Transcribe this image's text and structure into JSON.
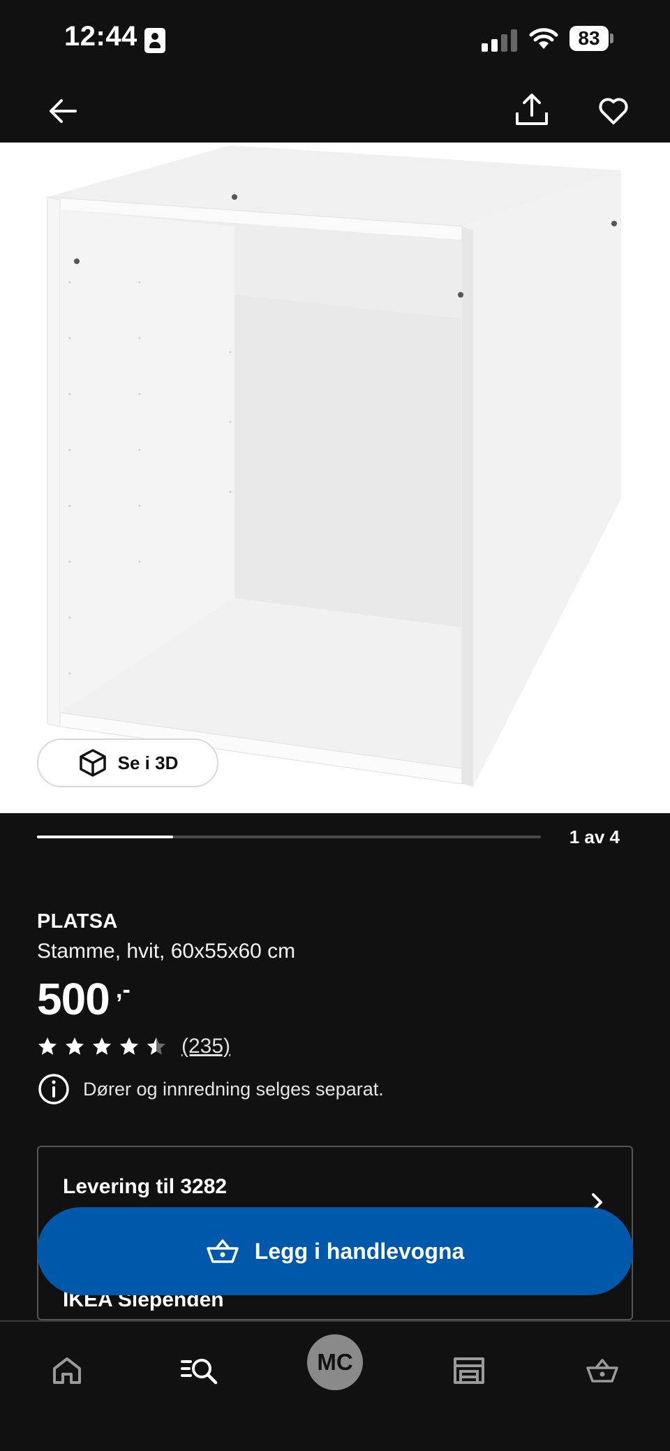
{
  "status_bar": {
    "time": "12:44",
    "battery": "83"
  },
  "product": {
    "image_counter": "1 av 4",
    "image_progress": 0.27,
    "view_3d_label": "Se i 3D",
    "brand": "PLATSA",
    "description": "Stamme, hvit, 60x55x60 cm",
    "price": "500",
    "price_suffix": ",-",
    "rating": 4.5,
    "review_count": "(235)",
    "notice": "Dører og innredning selges separat."
  },
  "delivery": {
    "title": "Levering til 3282",
    "store": "IKEA Slependen"
  },
  "cta": {
    "add_to_cart": "Legg i handlevogna"
  },
  "tab_bar": {
    "profile_initials": "MC"
  },
  "colors": {
    "background": "#111111",
    "accent": "#0058ab",
    "image_bg": "#ffffff"
  }
}
